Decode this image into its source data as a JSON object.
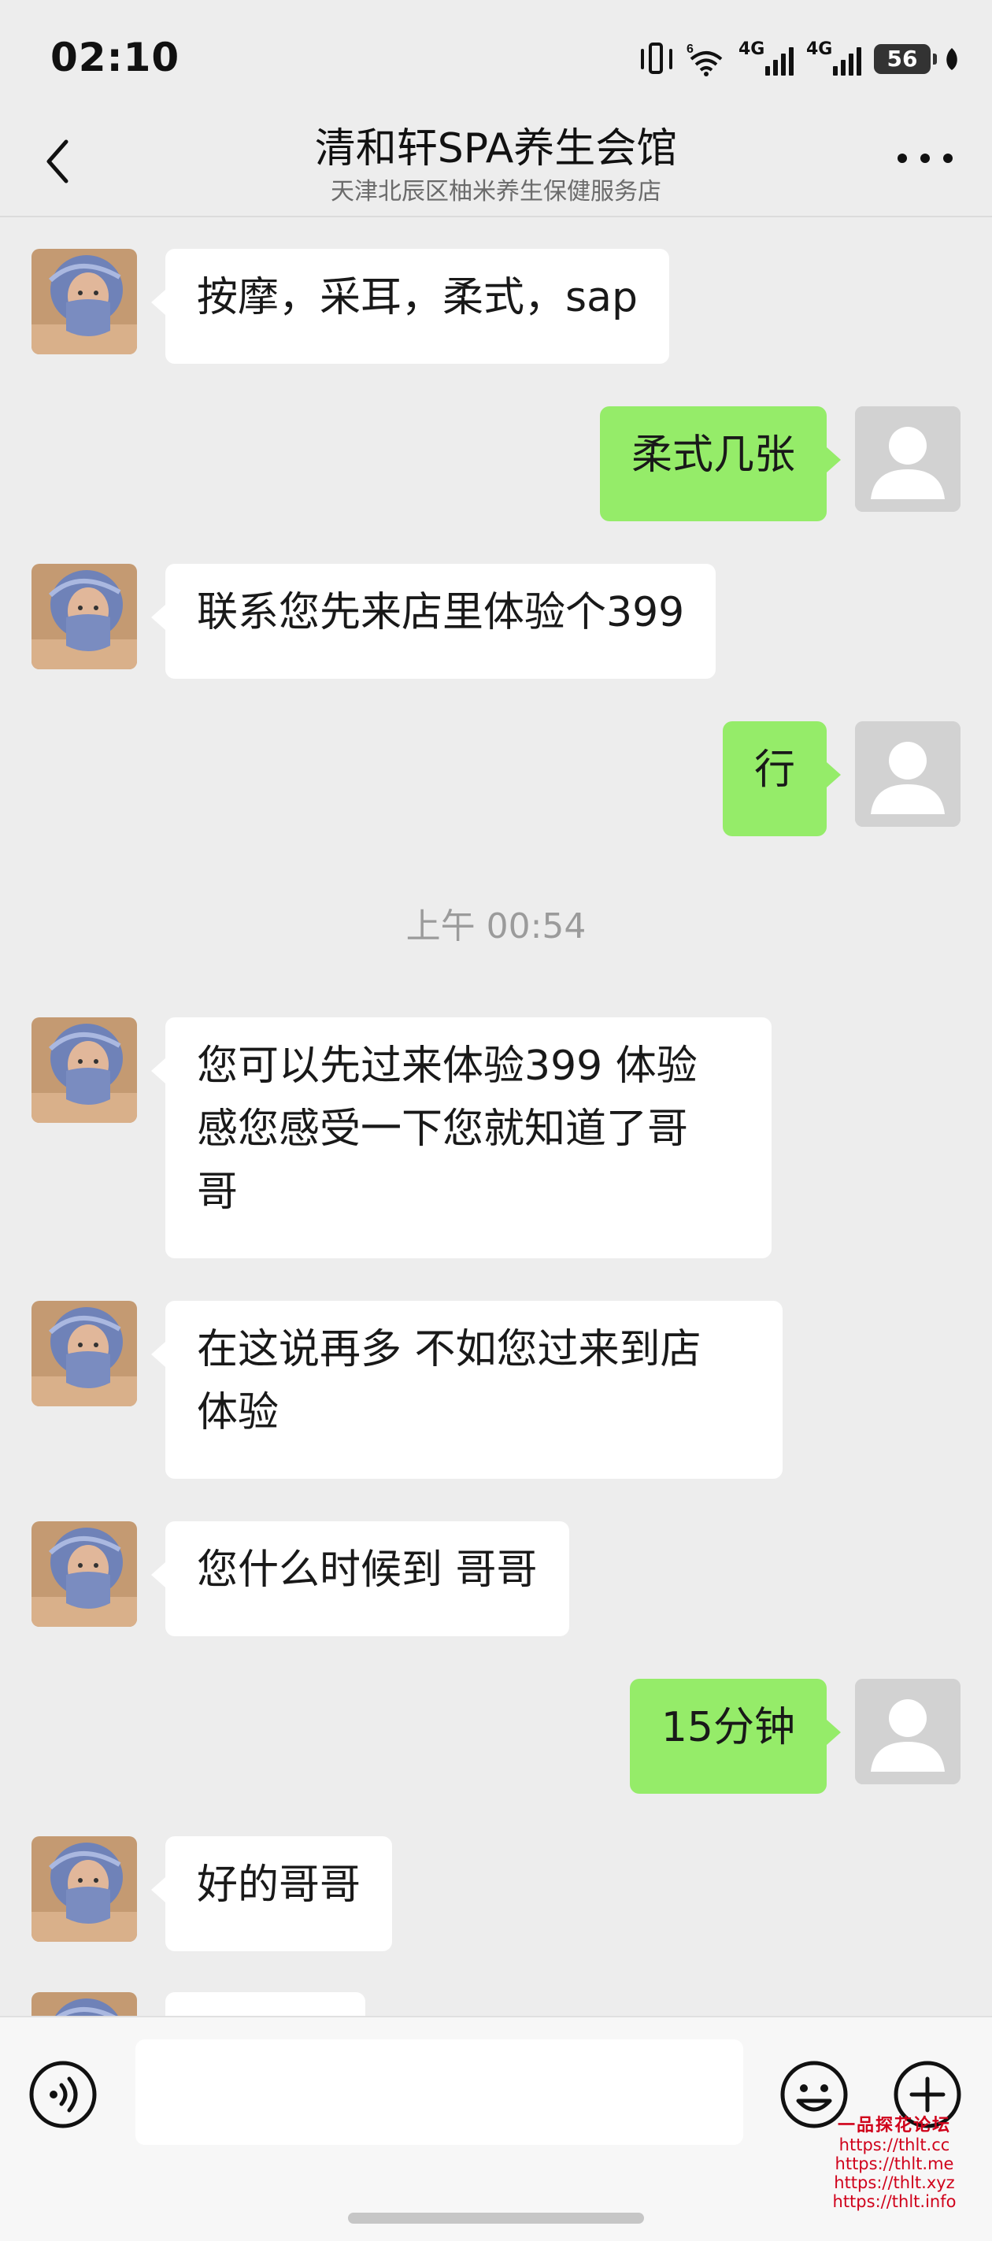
{
  "status_bar": {
    "time": "02:10",
    "network_1": "4G",
    "network_2": "4G",
    "wifi_label": "6",
    "battery": "56"
  },
  "header": {
    "title": "清和轩SPA养生会馆",
    "subtitle": "天津北辰区柚米养生保健服务店"
  },
  "messages": [
    {
      "side": "in",
      "text": "按摩，采耳，柔式，sap"
    },
    {
      "side": "out",
      "text": "柔式几张"
    },
    {
      "side": "in",
      "text": "联系您先来店里体验个399"
    },
    {
      "side": "out",
      "text": "行"
    },
    {
      "side": "time",
      "text": "上午 00:54"
    },
    {
      "side": "in",
      "line1": "您可以先过来体验399 体验",
      "line2": "感您感受一下您就知道了哥",
      "line3": "哥"
    },
    {
      "side": "in",
      "line1": "在这说再多 不如您过来到店",
      "line2": "体验"
    },
    {
      "side": "in",
      "text": "您什么时候到 哥哥"
    },
    {
      "side": "out",
      "text": "15分钟"
    },
    {
      "side": "in",
      "text": "好的哥哥"
    }
  ],
  "input": {
    "value": "",
    "icons": [
      "voice-icon",
      "emoji-icon",
      "plus-icon"
    ]
  },
  "watermark": {
    "brand": "一品探花论坛",
    "lines": [
      "https://thlt.cc",
      "https://thlt.me",
      "https://thlt.xyz",
      "https://thlt.info"
    ]
  },
  "colors": {
    "background": "#ededed",
    "incoming_bubble": "#ffffff",
    "outgoing_bubble": "#95ec69",
    "timestamp": "#9b9b9b",
    "watermark": "#d0021b"
  }
}
